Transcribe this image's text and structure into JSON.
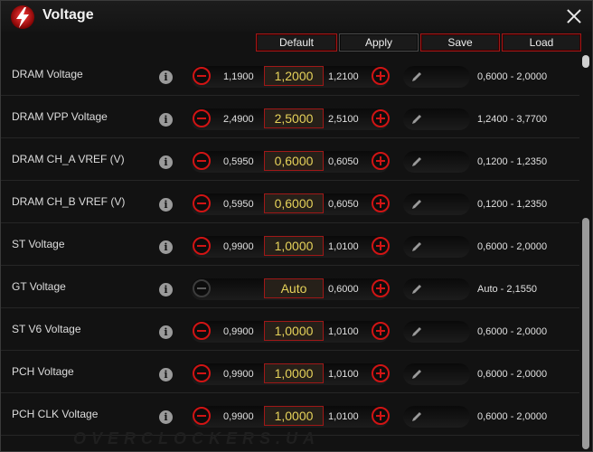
{
  "window": {
    "title": "Voltage",
    "watermark": "OVERCLOCKERS.UA"
  },
  "actions": {
    "default": "Default",
    "apply": "Apply",
    "save": "Save",
    "load": "Load"
  },
  "rows": [
    {
      "label": "DRAM Voltage",
      "low": "1,1900",
      "value": "1,2000",
      "high": "1,2100",
      "range": "0,6000 - 2,0000"
    },
    {
      "label": "DRAM VPP Voltage",
      "low": "2,4900",
      "value": "2,5000",
      "high": "2,5100",
      "range": "1,2400 - 3,7700"
    },
    {
      "label": "DRAM CH_A VREF (V)",
      "low": "0,5950",
      "value": "0,6000",
      "high": "0,6050",
      "range": "0,1200 - 1,2350"
    },
    {
      "label": "DRAM CH_B VREF (V)",
      "low": "0,5950",
      "value": "0,6000",
      "high": "0,6050",
      "range": "0,1200 - 1,2350"
    },
    {
      "label": "ST Voltage",
      "low": "0,9900",
      "value": "1,0000",
      "high": "1,0100",
      "range": "0,6000 - 2,0000"
    },
    {
      "label": "GT Voltage",
      "low": "",
      "value": "Auto",
      "high": "0,6000",
      "range": "Auto - 2,1550"
    },
    {
      "label": "ST V6 Voltage",
      "low": "0,9900",
      "value": "1,0000",
      "high": "1,0100",
      "range": "0,6000 - 2,0000"
    },
    {
      "label": "PCH Voltage",
      "low": "0,9900",
      "value": "1,0000",
      "high": "1,0100",
      "range": "0,6000 - 2,0000"
    },
    {
      "label": "PCH CLK Voltage",
      "low": "0,9900",
      "value": "1,0000",
      "high": "1,0100",
      "range": "0,6000 - 2,0000"
    }
  ]
}
